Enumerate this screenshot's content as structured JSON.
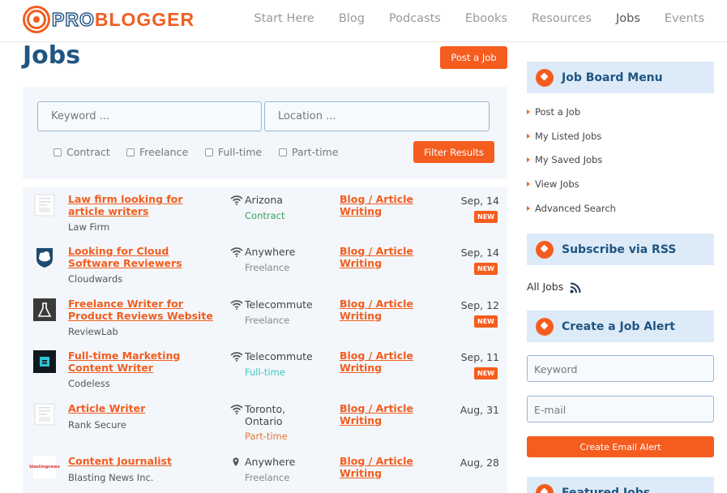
{
  "header": {
    "logo_pro": "PRO",
    "logo_blogger": "BLOGGER",
    "nav": [
      "Start Here",
      "Blog",
      "Podcasts",
      "Ebooks",
      "Resources",
      "Jobs",
      "Events"
    ],
    "active_nav": "Jobs"
  },
  "page": {
    "title": "Jobs",
    "post_job_label": "Post a Job"
  },
  "search": {
    "keyword_placeholder": "Keyword ...",
    "location_placeholder": "Location ...",
    "filters": [
      "Contract",
      "Freelance",
      "Full-time",
      "Part-time"
    ],
    "filter_button": "Filter Results"
  },
  "jobs": [
    {
      "title": "Law firm looking for article writers",
      "company": "Law Firm",
      "location": "Arizona",
      "location_icon": "wifi-icon",
      "type": "Contract",
      "type_color": "#3aa05a",
      "category": "Blog / Article Writing",
      "date": "Sep, 14",
      "badge": "NEW",
      "logo_icon": "document-logo-icon"
    },
    {
      "title": "Looking for Cloud Software Reviewers",
      "company": "Cloudwards",
      "location": "Anywhere",
      "location_icon": "wifi-icon",
      "type": "Freelance",
      "type_color": "#888888",
      "category": "Blog / Article Writing",
      "date": "Sep, 14",
      "badge": "NEW",
      "logo_icon": "cloud-shield-logo-icon"
    },
    {
      "title": "Freelance Writer for Product Reviews Website",
      "company": "ReviewLab",
      "location": "Telecommute",
      "location_icon": "wifi-icon",
      "type": "Freelance",
      "type_color": "#888888",
      "category": "Blog / Article Writing",
      "date": "Sep, 12",
      "badge": "NEW",
      "logo_icon": "flask-logo-icon"
    },
    {
      "title": "Full-time Marketing Content Writer",
      "company": "Codeless",
      "location": "Telecommute",
      "location_icon": "wifi-icon",
      "type": "Full-time",
      "type_color": "#3ec6c0",
      "category": "Blog / Article Writing",
      "date": "Sep, 11",
      "badge": "NEW",
      "logo_icon": "square-logo-icon"
    },
    {
      "title": "Article Writer",
      "company": "Rank Secure",
      "location": "Toronto, Ontario",
      "location_icon": "wifi-icon",
      "type": "Part-time",
      "type_color": "#e8743a",
      "category": "Blog / Article Writing",
      "date": "Aug, 31",
      "badge": "",
      "logo_icon": "document-logo-icon"
    },
    {
      "title": "Content Journalist",
      "company": "Blasting News Inc.",
      "location": "Anywhere",
      "location_icon": "map-pin-icon",
      "type": "Freelance",
      "type_color": "#888888",
      "category": "Blog / Article Writing",
      "date": "Aug, 28",
      "badge": "",
      "logo_icon": "blasting-news-logo-icon",
      "logo_text": "blastingnews"
    }
  ],
  "sidebar": {
    "menu_title": "Job Board Menu",
    "menu_items": [
      "Post a Job",
      "My Listed Jobs",
      "My Saved Jobs",
      "View Jobs",
      "Advanced Search"
    ],
    "rss_title": "Subscribe via RSS",
    "rss_link": "All Jobs",
    "alert_title": "Create a Job Alert",
    "alert_keyword_placeholder": "Keyword",
    "alert_email_placeholder": "E-mail",
    "alert_button": "Create Email Alert",
    "featured_title": "Featured Jobs"
  },
  "colors": {
    "accent": "#f55d1e",
    "brand_blue": "#1f5582",
    "panel_bg": "#f3f7fb",
    "sidebar_head_bg": "#ddeaf8"
  }
}
